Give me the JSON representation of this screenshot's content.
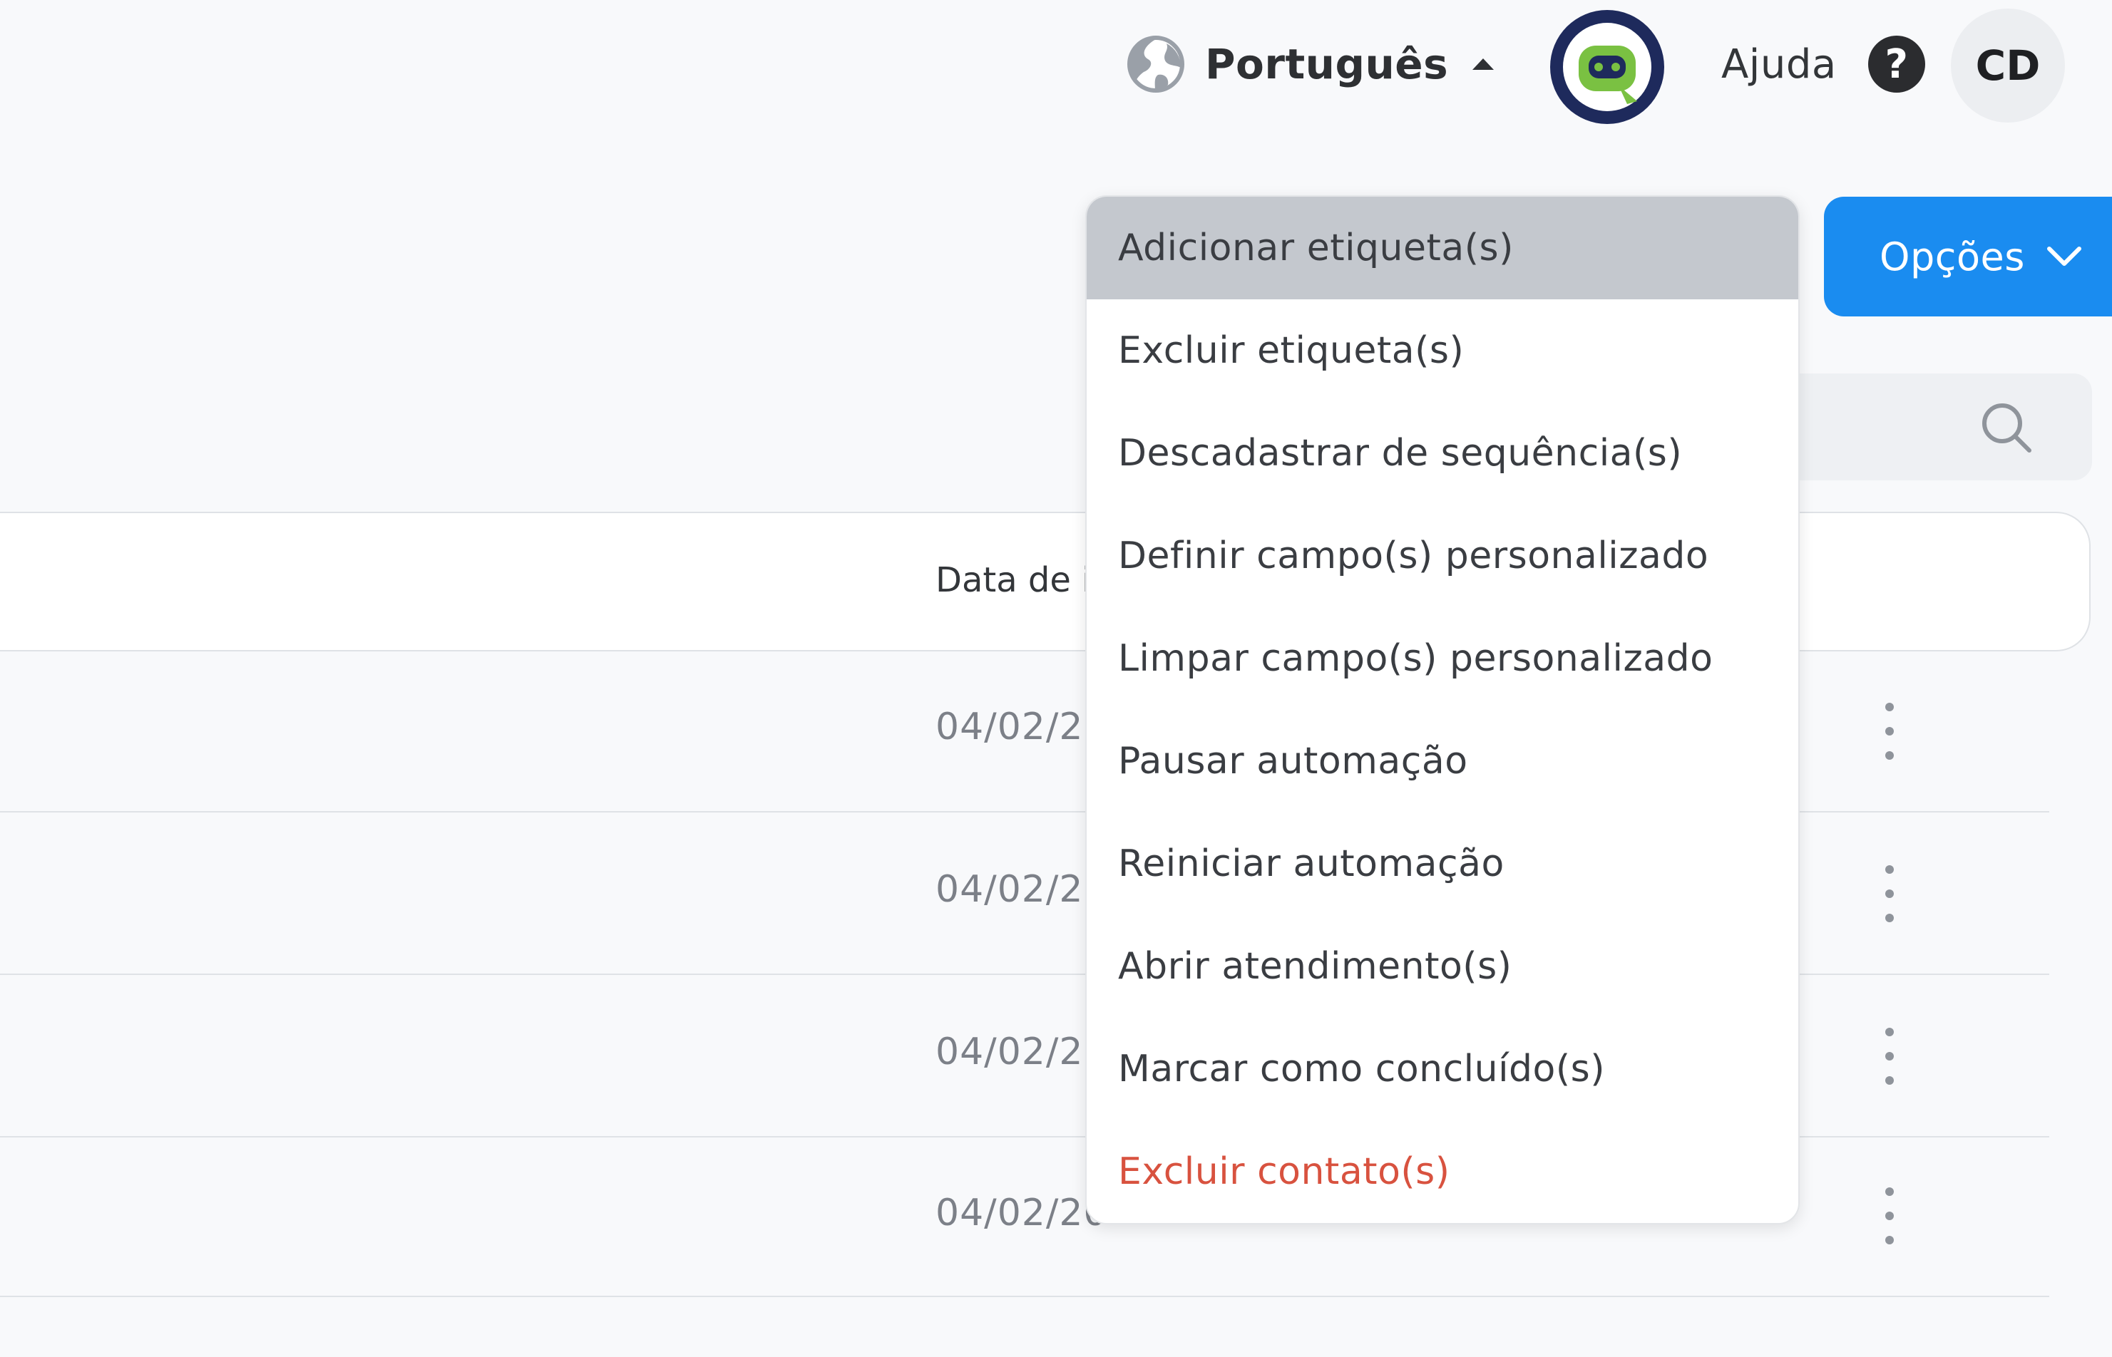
{
  "header": {
    "language_label": "Português",
    "help_label": "Ajuda",
    "help_symbol": "?",
    "user_initials": "CD"
  },
  "toolbar": {
    "options_label": "Opções"
  },
  "table": {
    "columns": [
      "Data de i"
    ],
    "rows": [
      {
        "date": "04/02/20"
      },
      {
        "date": "04/02/20"
      },
      {
        "date": "04/02/20"
      },
      {
        "date": "04/02/20"
      }
    ]
  },
  "dropdown": {
    "items": [
      {
        "label": "Adicionar etiqueta(s)"
      },
      {
        "label": "Excluir etiqueta(s)"
      },
      {
        "label": "Descadastrar de sequência(s)"
      },
      {
        "label": "Definir campo(s) personalizado"
      },
      {
        "label": "Limpar campo(s) personalizado"
      },
      {
        "label": "Pausar automação"
      },
      {
        "label": "Reiniciar automação"
      },
      {
        "label": "Abrir atendimento(s)"
      },
      {
        "label": "Marcar como concluído(s)"
      },
      {
        "label": "Excluir contato(s)"
      }
    ]
  },
  "colors": {
    "primary": "#1a8cf0",
    "danger": "#d8523f",
    "hover": "#c4c8ce",
    "bot_ring": "#1e2a5c",
    "bot_face": "#7ac142"
  },
  "icons": [
    "globe-icon",
    "caret-up-icon",
    "bot-avatar-icon",
    "help-icon",
    "chevron-down-icon",
    "search-icon",
    "kebab-icon"
  ]
}
